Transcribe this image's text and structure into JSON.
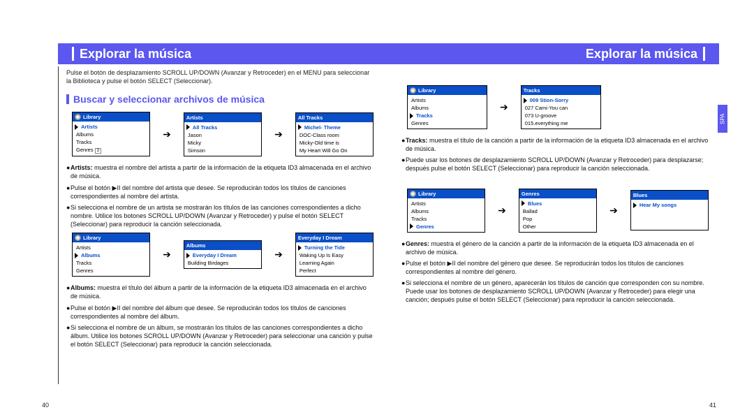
{
  "header": {
    "left": "Explorar la música",
    "right": "Explorar la música"
  },
  "spa": "SPA",
  "page_left": "40",
  "page_right": "41",
  "left": {
    "intro": "Pulse el botón de desplazamiento SCROLL UP/DOWN (Avanzar y Retroceder) en el MENU para seleccionar la Biblioteca y pulse el botón SELECT (Seleccionar).",
    "section": "Buscar y seleccionar archivos de música",
    "row1": {
      "s1": {
        "title": "Library",
        "items": [
          {
            "t": "Artists",
            "sel": true
          },
          {
            "t": "Albums"
          },
          {
            "t": "Tracks"
          },
          {
            "t": "Genres"
          }
        ],
        "extra": "3"
      },
      "s2": {
        "title": "Artists",
        "items": [
          {
            "t": "All Tracks",
            "sel": true
          },
          {
            "t": "Jason"
          },
          {
            "t": "Micky"
          },
          {
            "t": "Simson"
          }
        ]
      },
      "s3": {
        "title": "All Tracks",
        "items": [
          {
            "t": "Michel- Theme",
            "sel": true
          },
          {
            "t": "DOC-Class room"
          },
          {
            "t": "Micky-Old time is"
          },
          {
            "t": "My Heart Will Go On"
          }
        ]
      }
    },
    "b1": [
      {
        "lead": "Artists:",
        "t": " muestra el nombre del artista a partir de la información de la etiqueta ID3 almacenada en el archivo de música."
      },
      {
        "t": "Pulse el botón ▶II del nombre del artista que desee.\nSe reproducirán todos los títulos de canciones correspondientes al nombre del artista."
      },
      {
        "t": "Si selecciona el nombre de un artista se mostrarán los títulos de las canciones correspondientes a dicho nombre. Utilice los botones SCROLL UP/DOWN (Avanzar y Retroceder) y pulse el botón SELECT (Seleccionar) para reproducir la canción seleccionada."
      }
    ],
    "row2": {
      "s1": {
        "title": "Library",
        "items": [
          {
            "t": "Artists"
          },
          {
            "t": "Albums",
            "sel": true
          },
          {
            "t": "Tracks"
          },
          {
            "t": "Genres"
          }
        ]
      },
      "s2": {
        "title": "Albums",
        "items": [
          {
            "t": "Everyday I Dream",
            "sel": true
          },
          {
            "t": "Building Birdages"
          }
        ]
      },
      "s3": {
        "title": "Everyday I Dream",
        "items": [
          {
            "t": "Turning the Tide",
            "sel": true
          },
          {
            "t": "Waking Up Is Easy"
          },
          {
            "t": "Learning Again"
          },
          {
            "t": "Perfect"
          }
        ]
      }
    },
    "b2": [
      {
        "lead": "Albums:",
        "t": " muestra el título del álbum a partir de la información de la etiqueta ID3 almacenada en el archivo de música."
      },
      {
        "t": "Pulse el botón ▶II del nombre del álbum que desee.\nSe reproducirán todos los títulos de canciones correspondientes al nombre del álbum."
      },
      {
        "t": "Si selecciona el nombre de un álbum, se mostrarán los títulos de las canciones correspondientes a dicho álbum. Utilice los botones SCROLL UP/DOWN (Avanzar y Retroceder) para seleccionar una canción y pulse el botón SELECT (Seleccionar) para reproducir la canción seleccionada."
      }
    ]
  },
  "right": {
    "row1": {
      "s1": {
        "title": "Library",
        "items": [
          {
            "t": "Artists"
          },
          {
            "t": "Albums"
          },
          {
            "t": "Tracks",
            "sel": true
          },
          {
            "t": "Genres"
          }
        ]
      },
      "s2": {
        "title": "Tracks",
        "items": [
          {
            "t": "009 Stion-Sorry",
            "sel": true
          },
          {
            "t": "027 Cami-You can"
          },
          {
            "t": "073 U-groove"
          },
          {
            "t": "015.everything me"
          }
        ]
      }
    },
    "b1": [
      {
        "lead": "Tracks:",
        "t": " muestra el título de la canción a partir de la información de la etiqueta ID3 almacenada en el archivo de música."
      },
      {
        "t": "Puede usar los botones de desplazamiento SCROLL UP/DOWN (Avanzar y Retroceder) para desplazarse;\ndespués pulse el botón SELECT (Seleccionar) para reproducir la canción seleccionada."
      }
    ],
    "row2": {
      "s1": {
        "title": "Library",
        "items": [
          {
            "t": "Artists"
          },
          {
            "t": "Albums"
          },
          {
            "t": "Tracks"
          },
          {
            "t": "Genres",
            "sel": true
          }
        ]
      },
      "s2": {
        "title": "Genres",
        "items": [
          {
            "t": "Blues",
            "sel": true
          },
          {
            "t": "Ballad"
          },
          {
            "t": "Pop"
          },
          {
            "t": "Other"
          }
        ]
      },
      "s3": {
        "title": "Blues",
        "items": [
          {
            "t": "Hear My songs",
            "sel": true
          }
        ]
      }
    },
    "b2": [
      {
        "lead": "Genres:",
        "t": " muestra el género de la canción a partir de la información de la etiqueta ID3 almacenada en el archivo de música."
      },
      {
        "t": "Pulse el botón ▶II del nombre del género que desee.\nSe reproducirán todos los títulos de canciones correspondientes al nombre del género."
      },
      {
        "t": "Si selecciona el nombre de un género, aparecerán los títulos de canción que corresponden con su nombre. Puede usar los botones de desplazamiento SCROLL UP/DOWN (Avanzar y Retroceder) para elegir una canción; después pulse el botón SELECT (Seleccionar) para reproducir la canción seleccionada."
      }
    ]
  }
}
